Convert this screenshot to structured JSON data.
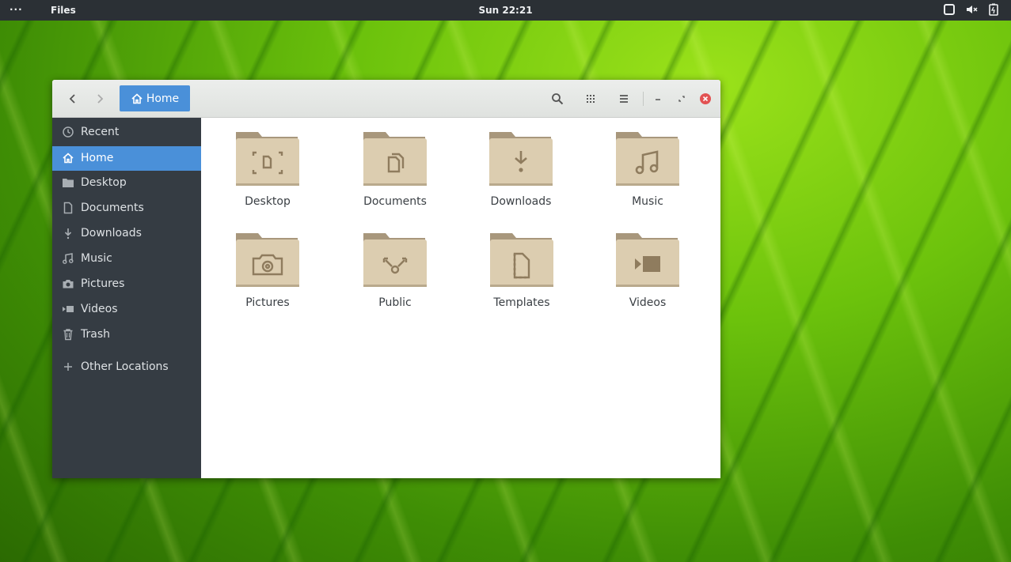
{
  "topbar": {
    "activities": "···",
    "app_name": "Files",
    "clock": "Sun 22:21",
    "tray_icons": [
      "window-icon",
      "volume-muted-icon",
      "battery-icon"
    ]
  },
  "headerbar": {
    "path_button_label": "Home",
    "buttons": [
      "back",
      "forward",
      "search",
      "view-grid",
      "menu",
      "minimize",
      "restore",
      "close"
    ]
  },
  "sidebar": {
    "items": [
      {
        "label": "Recent",
        "icon": "clock-icon",
        "active": false
      },
      {
        "label": "Home",
        "icon": "home-icon",
        "active": true
      },
      {
        "label": "Desktop",
        "icon": "folder-icon",
        "active": false
      },
      {
        "label": "Documents",
        "icon": "document-icon",
        "active": false
      },
      {
        "label": "Downloads",
        "icon": "download-icon",
        "active": false
      },
      {
        "label": "Music",
        "icon": "music-icon",
        "active": false
      },
      {
        "label": "Pictures",
        "icon": "camera-icon",
        "active": false
      },
      {
        "label": "Videos",
        "icon": "video-icon",
        "active": false
      },
      {
        "label": "Trash",
        "icon": "trash-icon",
        "active": false
      }
    ],
    "other_locations": "Other Locations"
  },
  "files": [
    {
      "label": "Desktop",
      "emblem": "desktop"
    },
    {
      "label": "Documents",
      "emblem": "documents"
    },
    {
      "label": "Downloads",
      "emblem": "downloads"
    },
    {
      "label": "Music",
      "emblem": "music"
    },
    {
      "label": "Pictures",
      "emblem": "pictures"
    },
    {
      "label": "Public",
      "emblem": "public"
    },
    {
      "label": "Templates",
      "emblem": "templates"
    },
    {
      "label": "Videos",
      "emblem": "videos"
    }
  ],
  "colors": {
    "accent": "#4a90d9",
    "sidebar_bg": "#353c43",
    "topbar_bg": "#2b3035",
    "folder_body": "#dccdb0",
    "folder_tab": "#a8977c",
    "close_red": "#e25252"
  }
}
